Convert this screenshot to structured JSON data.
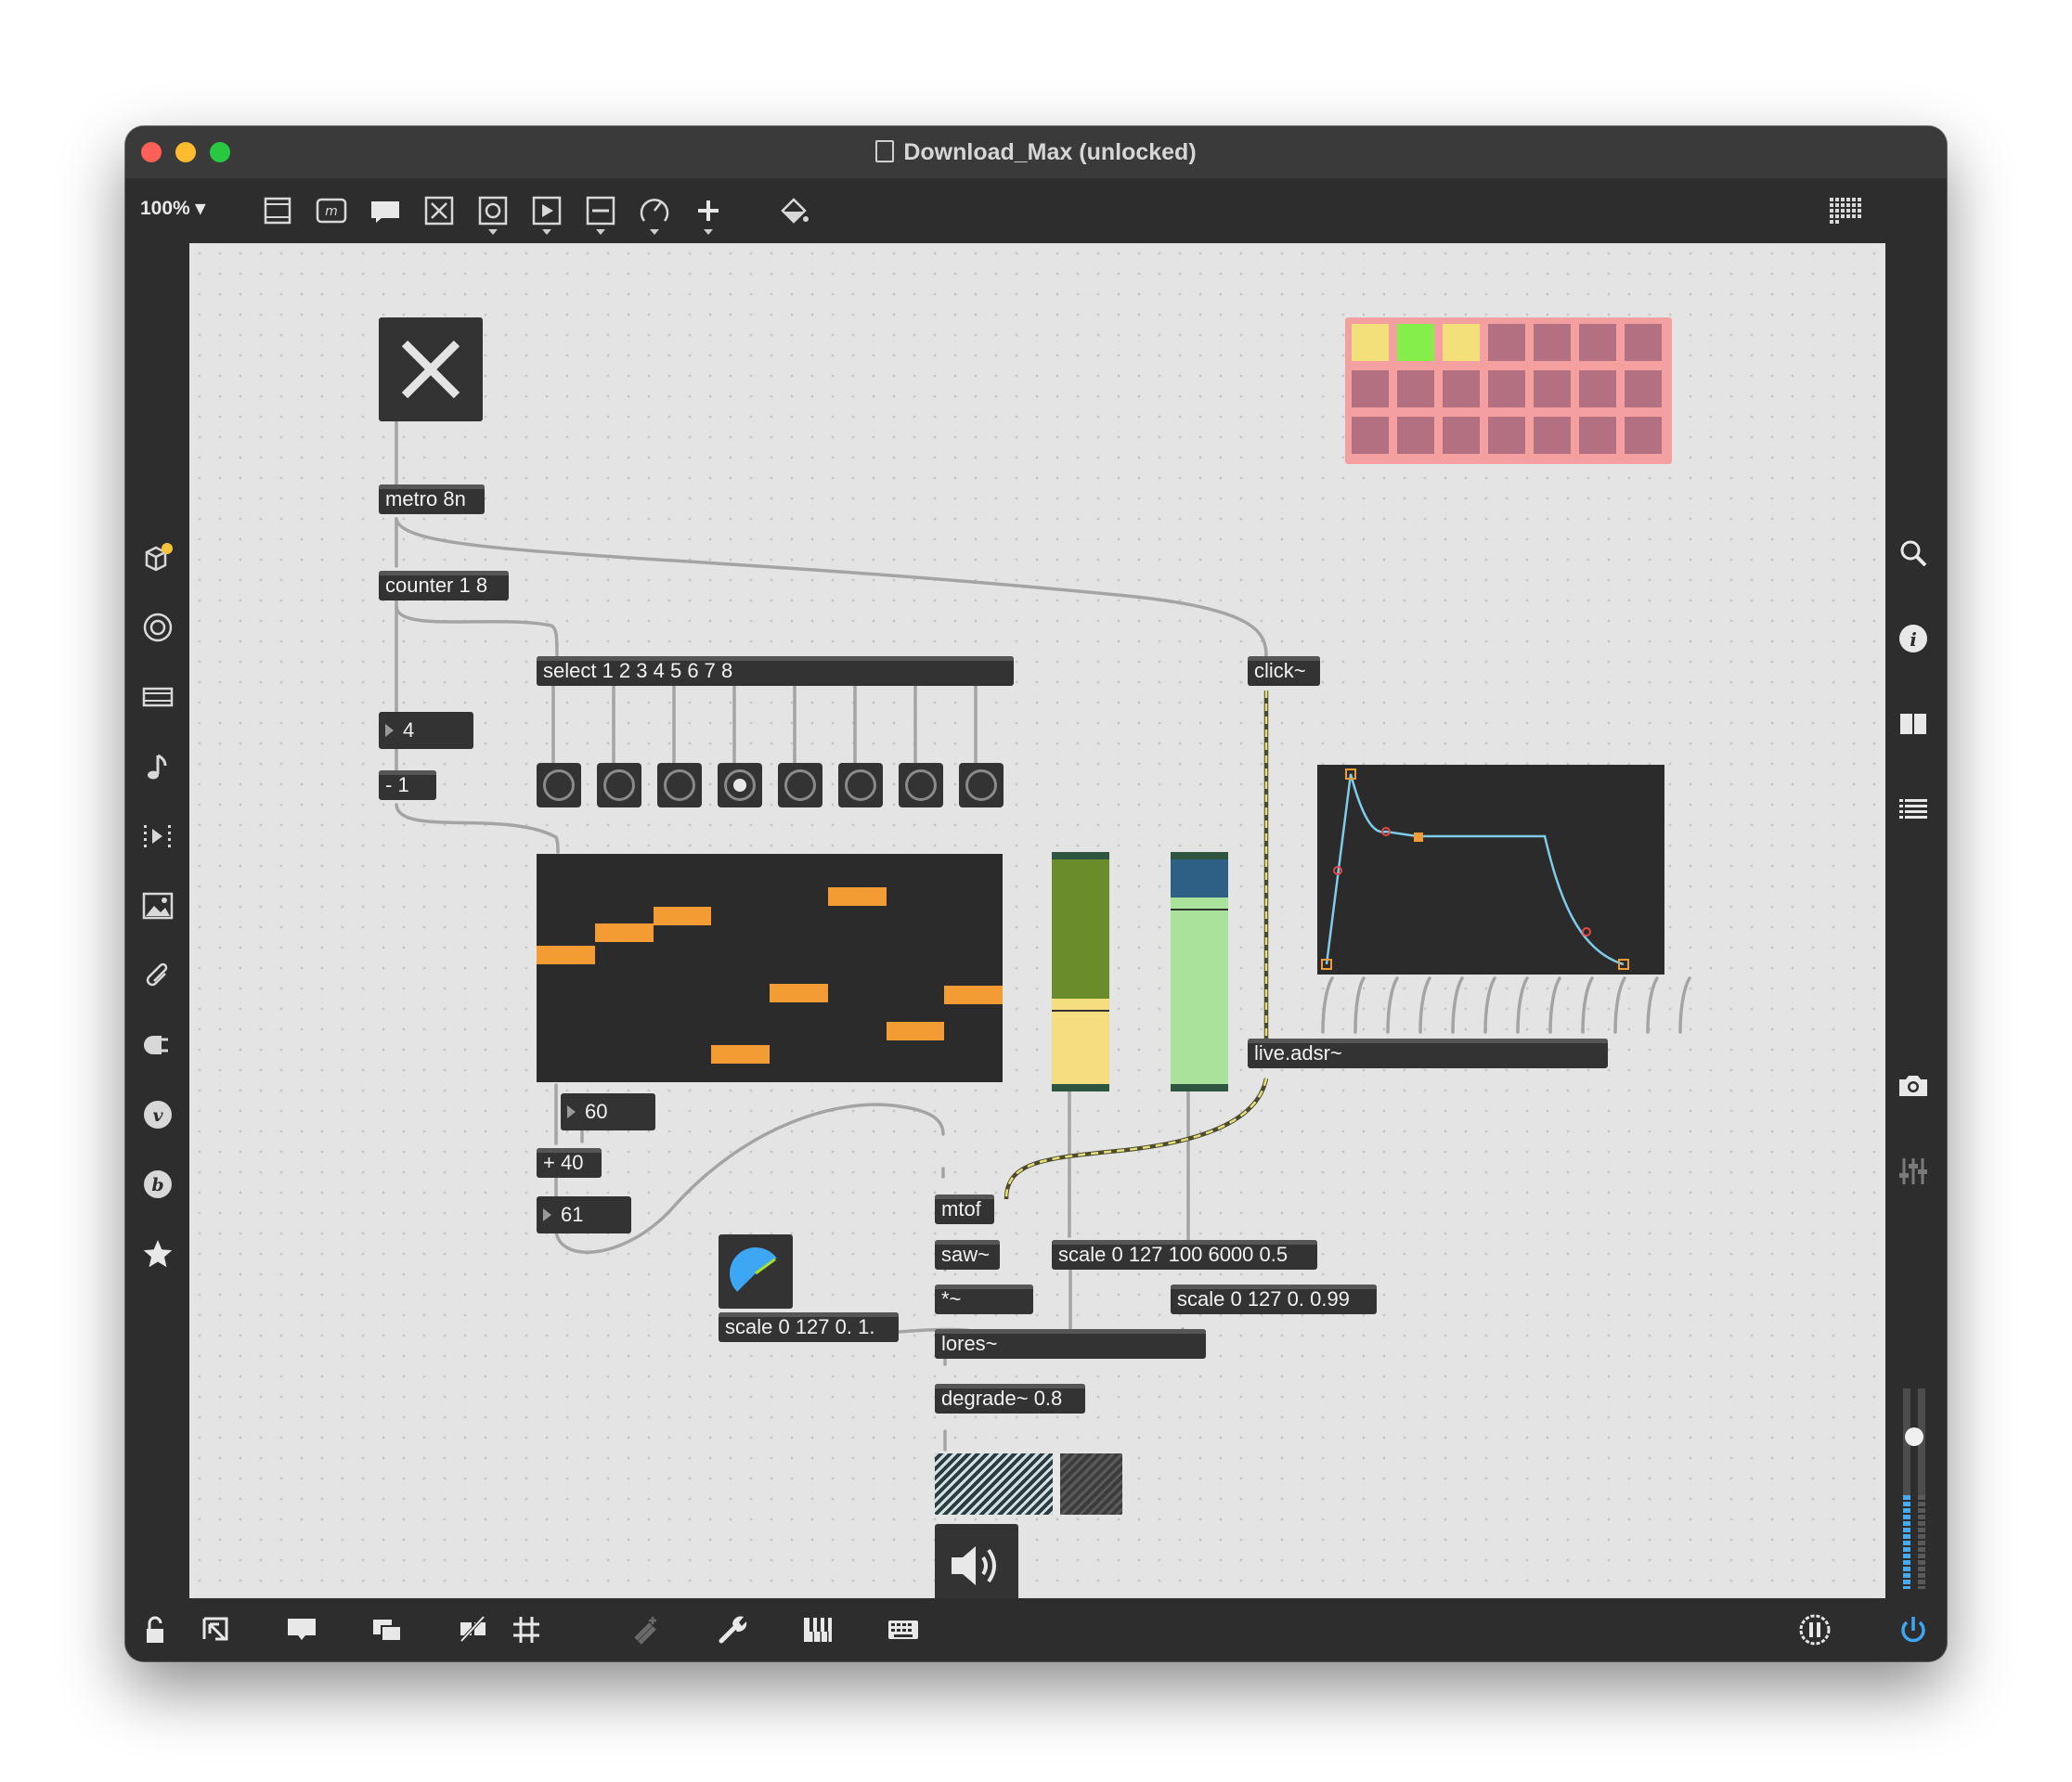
{
  "window": {
    "title": "Download_Max (unlocked)",
    "traffic_lights": [
      "close",
      "minimize",
      "zoom"
    ]
  },
  "toolbar": {
    "zoom": "100%",
    "tools": [
      "new-object-icon",
      "new-message-icon",
      "new-comment-icon",
      "toggle-icon",
      "bang-icon",
      "play-icon",
      "slider-icon",
      "dial-icon",
      "add-icon",
      "paint-bucket-icon"
    ],
    "right": "grid-view-icon"
  },
  "left_sidebar": [
    "packages-icon",
    "target-icon",
    "clip-icon",
    "note-icon",
    "step-icon",
    "image-icon",
    "paperclip-icon",
    "plug-icon",
    "v-icon",
    "b-icon",
    "star-icon"
  ],
  "right_sidebar": [
    "search-icon",
    "info-icon",
    "book-icon",
    "list-icon",
    "camera-icon",
    "mixer-icon"
  ],
  "bottom_bar": [
    "lock-icon",
    "presentation-icon",
    "comment-icon",
    "window-icon",
    "hide-icon",
    "grid-icon",
    "snap-icon",
    "wrench-icon",
    "piano-icon",
    "keyboard-icon",
    "pause-icon",
    "power-icon"
  ],
  "patch": {
    "metro": "metro 8n",
    "counter": "counter 1 8",
    "select": "select 1 2 3 4 5 6 7 8",
    "click": "click~",
    "num_count": "4",
    "minus": "- 1",
    "num_60": "60",
    "plus": "+ 40",
    "num_61": "61",
    "mtof": "mtof",
    "saw": "saw~",
    "mult": "*~",
    "scale1": "scale 0 127 100 6000 0.5",
    "scale2": "scale 0 127 0. 0.99",
    "scale3": "scale 0 127 0. 1.",
    "lores": "lores~",
    "degrade": "degrade~ 0.8",
    "adsr": "live.adsr~"
  },
  "bangs": {
    "count": 8,
    "active_index": 3
  },
  "grid_cells": {
    "rows": 3,
    "cols": 7,
    "on": [
      {
        "row": 0,
        "col": 0,
        "color": "#f4e07a"
      },
      {
        "row": 0,
        "col": 1,
        "color": "#86ee4a"
      },
      {
        "row": 0,
        "col": 2,
        "color": "#f4e07a"
      }
    ],
    "off_color": "#b27081",
    "bg_color": "#f4a0a0"
  },
  "sequencer_steps": [
    {
      "step": 0,
      "pitch": 0.56
    },
    {
      "step": 1,
      "pitch": 0.67
    },
    {
      "step": 2,
      "pitch": 0.75
    },
    {
      "step": 3,
      "pitch": 0.09
    },
    {
      "step": 4,
      "pitch": 0.38
    },
    {
      "step": 5,
      "pitch": 0.84
    },
    {
      "step": 6,
      "pitch": 0.2
    },
    {
      "step": 7,
      "pitch": 0.37
    }
  ],
  "sliders": [
    {
      "name": "green-slider",
      "value": 0.38,
      "fill": "#f6dd7f",
      "bg": "#6b8c2b"
    },
    {
      "name": "blue-slider",
      "value": 0.83,
      "fill": "#a9e29a",
      "bg": "#2e5f84"
    }
  ],
  "dial_value": 0.7,
  "gain_value": 0.65,
  "colors": {
    "canvas": "#e4e4e4",
    "object": "#333333",
    "accent_orange": "#f39c33",
    "adsr_line": "#7ecbea",
    "dial": "#3ea7f5"
  }
}
